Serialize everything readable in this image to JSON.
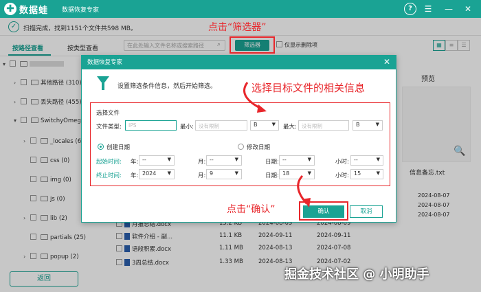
{
  "app": {
    "brand": "数据蛙",
    "subtitle": "数据恢复专家",
    "logo_glyph": "✚"
  },
  "scan": {
    "status": "扫描完成，找到1151个文件共598 MB。"
  },
  "annotations": {
    "filter_hint": "点击“筛选器”",
    "select_hint": "选择目标文件的相关信息",
    "confirm_hint": "点击“确认”"
  },
  "left_tabs": {
    "by_path": "按路径查看",
    "by_type": "按类型查看"
  },
  "toolbar": {
    "search_placeholder": "在此处输入文件名称或搜索路径",
    "filter_label": "筛选器",
    "only_deleted": "仅显示删除项"
  },
  "tree": {
    "items": [
      {
        "label": "其他路径 (310)"
      },
      {
        "label": "丢失路径 (455)"
      },
      {
        "label": "SwitchyOmega"
      },
      {
        "label": "_locales (6)"
      },
      {
        "label": "css (0)"
      },
      {
        "label": "img (0)"
      },
      {
        "label": "js (0)"
      },
      {
        "label": "lib (2)"
      },
      {
        "label": "partials (25)"
      },
      {
        "label": "popup (2)"
      }
    ]
  },
  "files": [
    {
      "name": "月报总结.docx",
      "size": "15.2 KB",
      "created": "2024-08-09",
      "modified": "2024-08-09"
    },
    {
      "name": "软件介绍 - 副...",
      "size": "11.1 KB",
      "created": "2024-09-11",
      "modified": "2024-09-11"
    },
    {
      "name": "语段积累.docx",
      "size": "1.11 MB",
      "created": "2024-08-13",
      "modified": "2024-07-08"
    },
    {
      "name": "3周总结.docx",
      "size": "1.33 MB",
      "created": "2024-08-13",
      "modified": "2024-07-02"
    }
  ],
  "preview": {
    "title": "预览",
    "filename": "信息备忘.txt",
    "dates": [
      "2024-08-07",
      "2024-08-07",
      "2024-08-07"
    ]
  },
  "bottom": {
    "back_label": "返回"
  },
  "watermark": "掘金技术社区 @ 小明助手",
  "dialog": {
    "title": "数据恢复专家",
    "info": "设置筛选条件信息，然后开始筛选。",
    "select_file": "选择文件",
    "file_type_label": "文件类型:",
    "file_type_placeholder": "IPS",
    "min_label": "最小:",
    "min_placeholder": "没有限制",
    "min_unit": "B",
    "max_label": "最大:",
    "max_placeholder": "没有限制",
    "max_unit": "B",
    "created_date": "创建日期",
    "modified_date": "修改日期",
    "start_label": "起始时间:",
    "end_label": "终止时间:",
    "year_label": "年:",
    "month_label": "月:",
    "day_label": "日期:",
    "hour_label": "小时:",
    "start": {
      "year": "--",
      "month": "--",
      "day": "--",
      "hour": "--"
    },
    "end": {
      "year": "2024",
      "month": "9",
      "day": "18",
      "hour": "15"
    },
    "ok_label": "确认",
    "cancel_label": "取消"
  },
  "colors": {
    "accent": "#1aa394",
    "annotation": "#e8262b"
  }
}
